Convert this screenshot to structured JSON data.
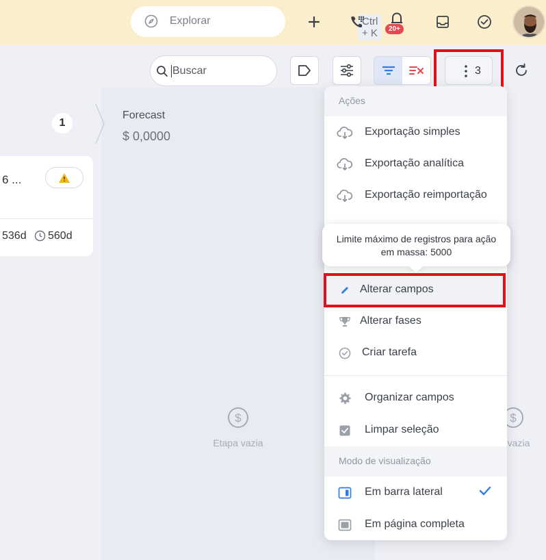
{
  "topbar": {
    "explore_label": "Explorar",
    "explore_shortcut": "Ctrl + K",
    "notification_badge": "20+"
  },
  "toolbar": {
    "search_placeholder": "Buscar",
    "selection_count": "3"
  },
  "board": {
    "step_number": "1",
    "forecast_label": "Forecast",
    "forecast_value": "$ 0,0000",
    "card": {
      "title_fragment": "6 ...",
      "days_a": "536d",
      "days_b": "560d"
    },
    "empty_label": "Etapa vazia",
    "empty_label_partial": "a vazia"
  },
  "menu": {
    "section_actions": "Ações",
    "items": [
      {
        "label": "Exportação simples",
        "icon": "cloud-download-icon"
      },
      {
        "label": "Exportação analítica",
        "icon": "cloud-download-icon"
      },
      {
        "label": "Exportação reimportação",
        "icon": "cloud-download-icon"
      },
      {
        "label": "Alterar campos",
        "icon": "pencil-icon"
      },
      {
        "label": "Alterar fases",
        "icon": "trophy-icon"
      },
      {
        "label": "Criar tarefa",
        "icon": "check-circle-icon"
      },
      {
        "label": "Organizar campos",
        "icon": "gear-icon"
      },
      {
        "label": "Limpar seleção",
        "icon": "checkbox-icon"
      }
    ],
    "section_view": "Modo de visualização",
    "view_items": [
      {
        "label": "Em barra lateral",
        "icon": "sidebar-icon",
        "selected": true
      },
      {
        "label": "Em página completa",
        "icon": "fullpage-icon",
        "selected": false
      }
    ],
    "tooltip": "Limite máximo de registros para ação em massa: 5000"
  },
  "colors": {
    "accent": "#2f7be8",
    "highlight_red": "#e0101a",
    "topbar_bg": "#fbeecd"
  }
}
